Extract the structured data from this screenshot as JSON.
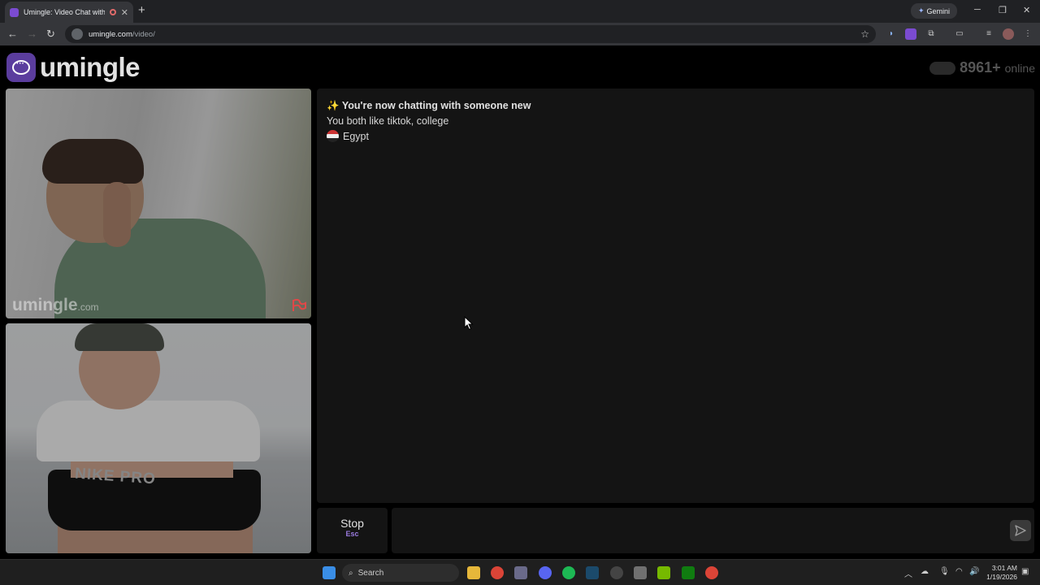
{
  "browser": {
    "tab_title": "Umingle: Video Chat with S",
    "tab_close": "✕",
    "new_tab": "+",
    "gemini_label": "Gemini",
    "url_host": "umingle.com",
    "url_path": "/video/"
  },
  "site": {
    "logo_text": "umingle",
    "online_count": "8961+",
    "online_label": "online"
  },
  "videos": {
    "watermark_main": "umingle",
    "watermark_suffix": ".com",
    "shorts_text": "NIKE PRO"
  },
  "chat": {
    "line1_icon": "✨",
    "line1": "You're now chatting with someone new",
    "line2": "You both like tiktok, college",
    "country": "Egypt"
  },
  "controls": {
    "stop_label": "Stop",
    "stop_key": "Esc",
    "message_placeholder": ""
  },
  "taskbar": {
    "search_placeholder": "Search",
    "time": "3:01 AM",
    "date": "1/19/2026"
  },
  "colors": {
    "brand": "#5b3d9e",
    "background": "#000000",
    "panel": "#141414"
  }
}
